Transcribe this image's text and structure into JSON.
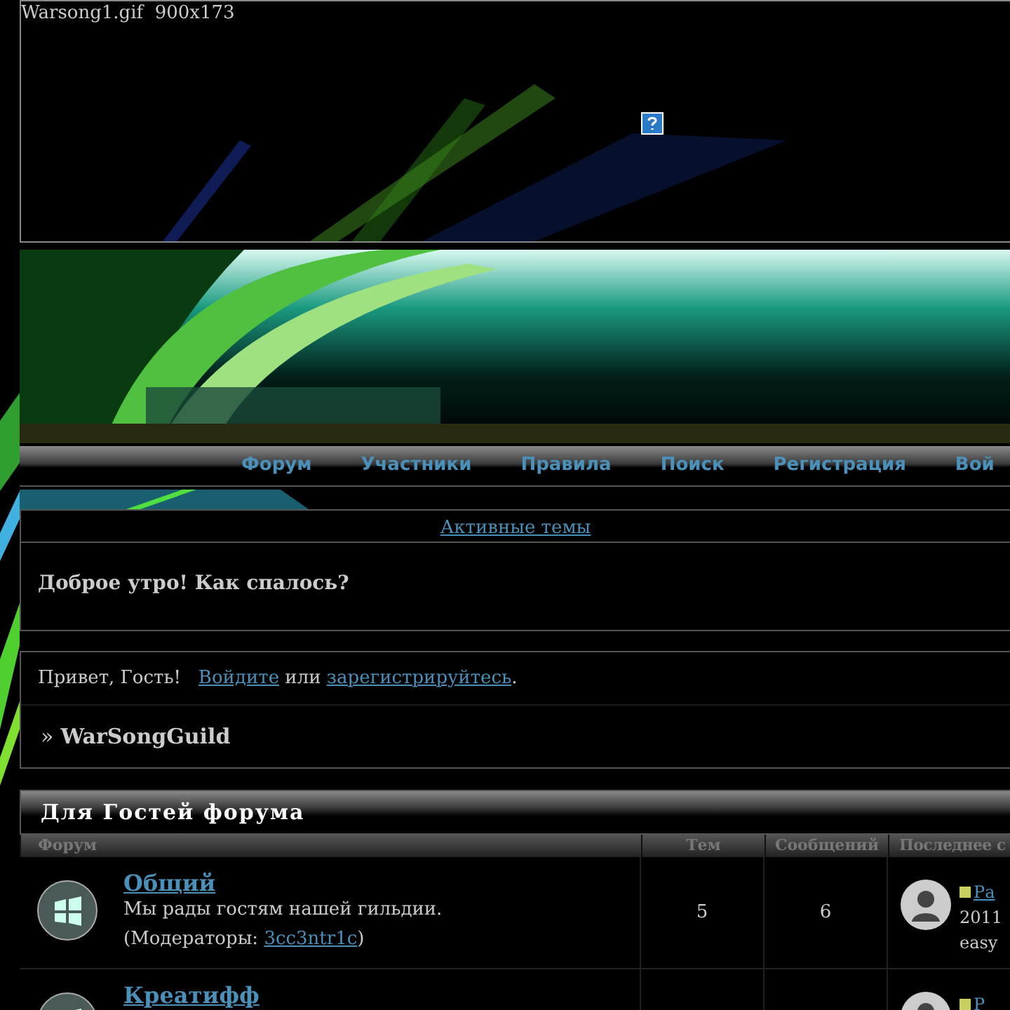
{
  "broken_image": {
    "alt": "Warsong1.gif  900x173"
  },
  "nav": [
    {
      "label": "Форум"
    },
    {
      "label": "Участники"
    },
    {
      "label": "Правила"
    },
    {
      "label": "Поиск"
    },
    {
      "label": "Регистрация"
    },
    {
      "label": "Вой"
    }
  ],
  "active_topics_link": "Активные темы",
  "announcement": "Доброе утро! Как спалось?",
  "welcome": {
    "greeting": "Привет, Гость!",
    "login_link": "Войдите",
    "or": "или",
    "register_link": "зарегистрируйтесь",
    "end": "."
  },
  "breadcrumb": {
    "sep": "»",
    "title": "WarSongGuild"
  },
  "category": {
    "title": "Для Гостей форума",
    "columns": [
      "Форум",
      "Тем",
      "Сообщений",
      "Последнее с"
    ],
    "rows": [
      {
        "name": "Общий",
        "description": "Мы рады гостям нашей гильдии.",
        "moderators_label": "(Модераторы:",
        "moderator": "3cc3ntr1c",
        "moderators_end": ")",
        "topics": "5",
        "posts": "6",
        "last_link": "Ра",
        "last_date": "2011",
        "last_user": "easy"
      },
      {
        "name": "Креатифф",
        "last_link": "Р"
      }
    ]
  }
}
